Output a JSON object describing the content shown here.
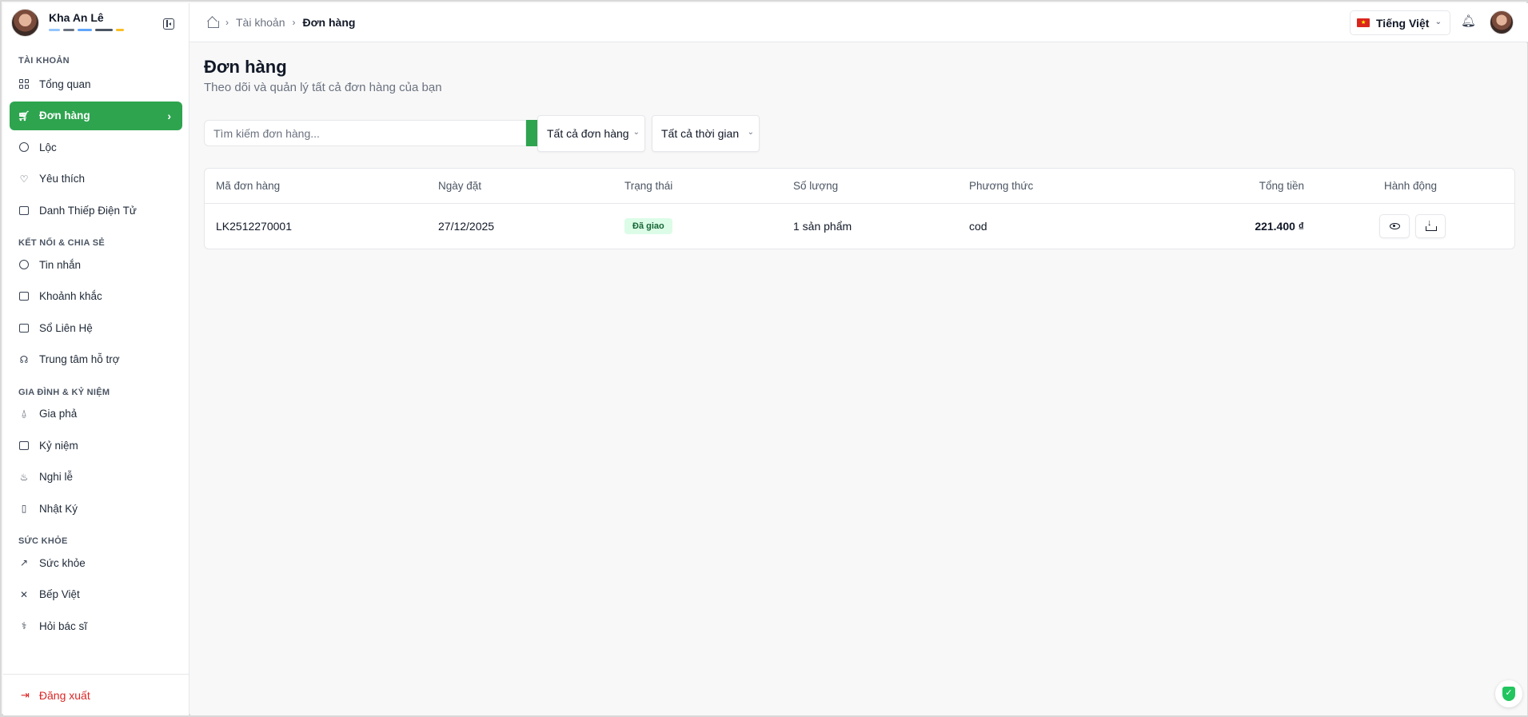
{
  "user": {
    "name": "Kha An Lê"
  },
  "sidebar": {
    "sections": [
      {
        "label": "TÀI KHOẢN",
        "items": [
          {
            "label": "Tổng quan",
            "icon": "dashboard-icon"
          },
          {
            "label": "Đơn hàng",
            "icon": "cart-icon",
            "active": true
          },
          {
            "label": "Lộc",
            "icon": "coin-icon"
          },
          {
            "label": "Yêu thích",
            "icon": "heart-icon"
          },
          {
            "label": "Danh Thiếp Điện Tử",
            "icon": "id-card-icon"
          }
        ]
      },
      {
        "label": "KẾT NỐI & CHIA SẺ",
        "items": [
          {
            "label": "Tin nhắn",
            "icon": "message-icon"
          },
          {
            "label": "Khoảnh khắc",
            "icon": "images-icon"
          },
          {
            "label": "Sổ Liên Hệ",
            "icon": "contacts-icon"
          },
          {
            "label": "Trung tâm hỗ trợ",
            "icon": "headset-icon"
          }
        ]
      },
      {
        "label": "GIA ĐÌNH & KỶ NIỆM",
        "items": [
          {
            "label": "Gia phả",
            "icon": "family-tree-icon"
          },
          {
            "label": "Kỷ niệm",
            "icon": "calendar-heart-icon"
          },
          {
            "label": "Nghi lễ",
            "icon": "flame-icon"
          },
          {
            "label": "Nhật Ký",
            "icon": "book-icon"
          }
        ]
      },
      {
        "label": "SỨC KHỎE",
        "items": [
          {
            "label": "Sức khỏe",
            "icon": "trending-up-icon"
          },
          {
            "label": "Bếp Việt",
            "icon": "utensils-icon"
          },
          {
            "label": "Hỏi bác sĩ",
            "icon": "stethoscope-icon"
          }
        ]
      }
    ],
    "logout_label": "Đăng xuất"
  },
  "breadcrumb": {
    "parent": "Tài khoản",
    "current": "Đơn hàng"
  },
  "language": {
    "label": "Tiếng Việt"
  },
  "page": {
    "title": "Đơn hàng",
    "subtitle": "Theo dõi và quản lý tất cả đơn hàng của bạn"
  },
  "filters": {
    "search_placeholder": "Tìm kiếm đơn hàng...",
    "status_value": "Tất cả đơn hàng",
    "time_value": "Tất cả thời gian"
  },
  "table": {
    "headers": [
      "Mã đơn hàng",
      "Ngày đặt",
      "Trạng thái",
      "Số lượng",
      "Phương thức",
      "Tổng tiền",
      "Hành động"
    ],
    "rows": [
      {
        "id": "LK2512270001",
        "date": "27/12/2025",
        "status": "Đã giao",
        "quantity": "1 sản phẩm",
        "method": "cod",
        "total": "221.400 ₫"
      }
    ]
  },
  "colors": {
    "accent": "#2ea44f",
    "danger": "#dc2626",
    "badge_bg": "#dcfce7"
  }
}
